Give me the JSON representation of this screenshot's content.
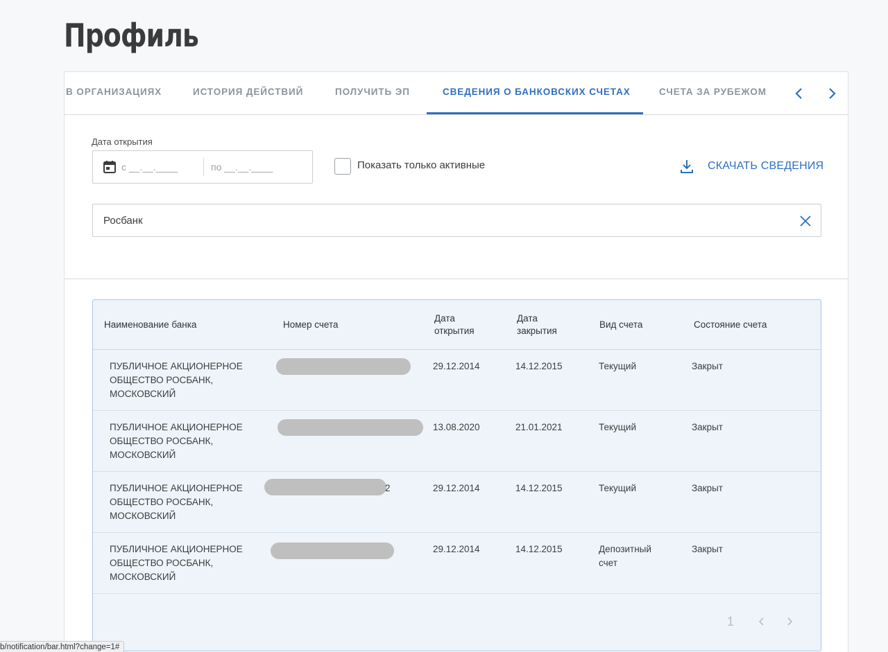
{
  "page": {
    "title": "Профиль"
  },
  "tabs": [
    {
      "label": "В ОРГАНИЗАЦИЯХ",
      "active": false
    },
    {
      "label": "ИСТОРИЯ ДЕЙСТВИЙ",
      "active": false
    },
    {
      "label": "ПОЛУЧИТЬ ЭП",
      "active": false
    },
    {
      "label": "СВЕДЕНИЯ О БАНКОВСКИХ СЧЕТАХ",
      "active": true
    },
    {
      "label": "СЧЕТА ЗА РУБЕЖОМ",
      "active": false
    }
  ],
  "tab_nav": {
    "prev_icon": "chevron-left-icon",
    "next_icon": "chevron-right-icon"
  },
  "filters": {
    "date_label": "Дата открытия",
    "date_from_placeholder": "с __.__.____",
    "date_to_placeholder": "по __.__.____",
    "active_only_label": "Показать только активные",
    "active_only_checked": false,
    "download_label": "СКАЧАТЬ СВЕДЕНИЯ",
    "search_value": "Росбанк"
  },
  "table": {
    "columns": [
      "Наименование банка",
      "Номер счета",
      "Дата открытия",
      "Дата закрытия",
      "Вид счета",
      "Состояние счета"
    ],
    "rows": [
      {
        "bank": "ПУБЛИЧНОЕ АКЦИОНЕРНОЕ ОБЩЕСТВО РОСБАНК, МОСКОВСКИЙ",
        "account": "",
        "opened": "29.12.2014",
        "closed": "14.12.2015",
        "type": "Текущий",
        "status": "Закрыт"
      },
      {
        "bank": "ПУБЛИЧНОЕ АКЦИОНЕРНОЕ ОБЩЕСТВО РОСБАНК, МОСКОВСКИЙ",
        "account": "",
        "opened": "13.08.2020",
        "closed": "21.01.2021",
        "type": "Текущий",
        "status": "Закрыт"
      },
      {
        "bank": "ПУБЛИЧНОЕ АКЦИОНЕРНОЕ ОБЩЕСТВО РОСБАНК, МОСКОВСКИЙ",
        "account": "2",
        "opened": "29.12.2014",
        "closed": "14.12.2015",
        "type": "Текущий",
        "status": "Закрыт"
      },
      {
        "bank": "ПУБЛИЧНОЕ АКЦИОНЕРНОЕ ОБЩЕСТВО РОСБАНК, МОСКОВСКИЙ",
        "account": "",
        "opened": "29.12.2014",
        "closed": "14.12.2015",
        "type": "Депозитный счет",
        "status": "Закрыт"
      }
    ]
  },
  "pagination": {
    "current_page": "1"
  },
  "status_bar": {
    "url": "b/notification/bar.html?change=1#"
  },
  "colors": {
    "accent": "#2f6fbf",
    "table_bg": "#eef4fa",
    "table_border": "#a7c7e6",
    "redaction": "#bfbfbf"
  }
}
